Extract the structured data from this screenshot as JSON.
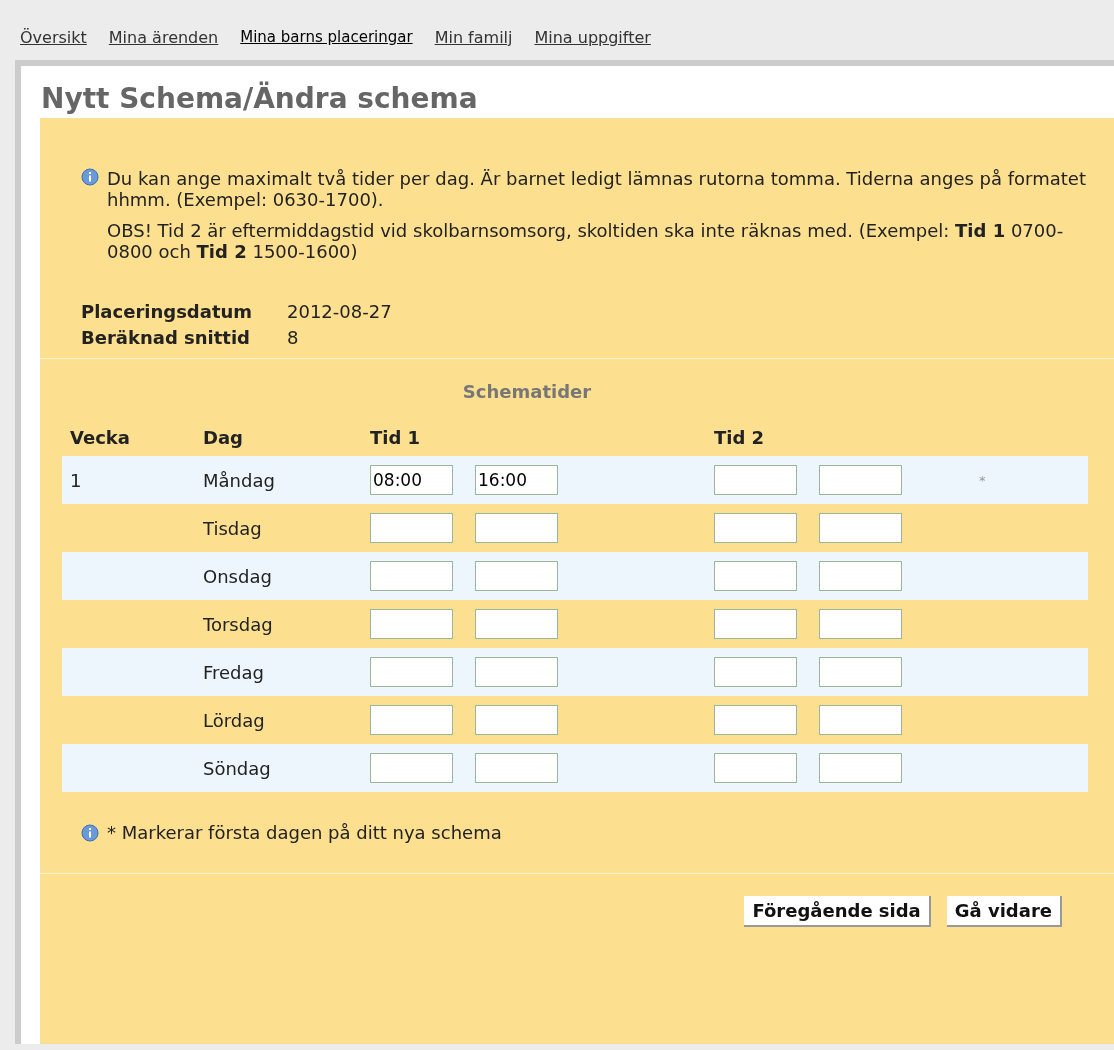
{
  "nav": [
    {
      "label": "Översikt",
      "selected": false
    },
    {
      "label": "Mina ärenden",
      "selected": false
    },
    {
      "label": "Mina barns placeringar",
      "selected": true
    },
    {
      "label": "Min familj",
      "selected": false
    },
    {
      "label": "Mina uppgifter",
      "selected": false
    }
  ],
  "title": "Nytt Schema/Ändra schema",
  "info": [
    "Du kan ange maximalt två tider per dag. Är barnet ledigt lämnas rutorna tomma. Tiderna anges på formatet hhmm. (Exempel: 0630-1700).",
    "OBS! Tid 2 är eftermiddagstid vid skolbarnsomsorg, skoltiden ska inte räknas med. (Exempel: **Tid 1** 0700-0800 och **Tid 2** 1500-1600)"
  ],
  "details": [
    {
      "label": "Placeringsdatum",
      "value": "2012-08-27"
    },
    {
      "label": "Beräknad snittid",
      "value": "8"
    }
  ],
  "schedule": {
    "heading": "Schematider",
    "columns": [
      "Vecka",
      "Dag",
      "Tid 1",
      "Tid 2"
    ],
    "rows": [
      {
        "week": "1",
        "day": "Måndag",
        "tid1_start": "08:00",
        "tid1_end": "16:00",
        "marker": "*"
      },
      {
        "day": "Tisdag"
      },
      {
        "day": "Onsdag"
      },
      {
        "day": "Torsdag"
      },
      {
        "day": "Fredag"
      },
      {
        "day": "Lördag"
      },
      {
        "day": "Söndag"
      }
    ]
  },
  "footnote": "* Markerar första dagen på ditt nya schema",
  "buttons": [
    "Föregående sida",
    "Gå vidare"
  ]
}
